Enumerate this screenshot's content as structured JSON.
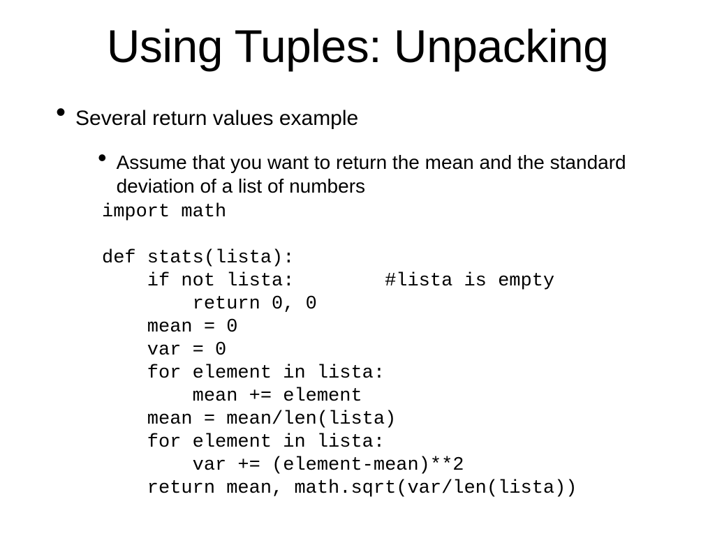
{
  "title": "Using Tuples: Unpacking",
  "bullet1": "Several return values example",
  "subbullet1": "Assume that you want to return the mean and the standard deviation of a list of numbers",
  "code": "import math\n\ndef stats(lista):\n    if not lista:        #lista is empty\n        return 0, 0\n    mean = 0\n    var = 0\n    for element in lista:\n        mean += element\n    mean = mean/len(lista)\n    for element in lista:\n        var += (element-mean)**2\n    return mean, math.sqrt(var/len(lista))"
}
